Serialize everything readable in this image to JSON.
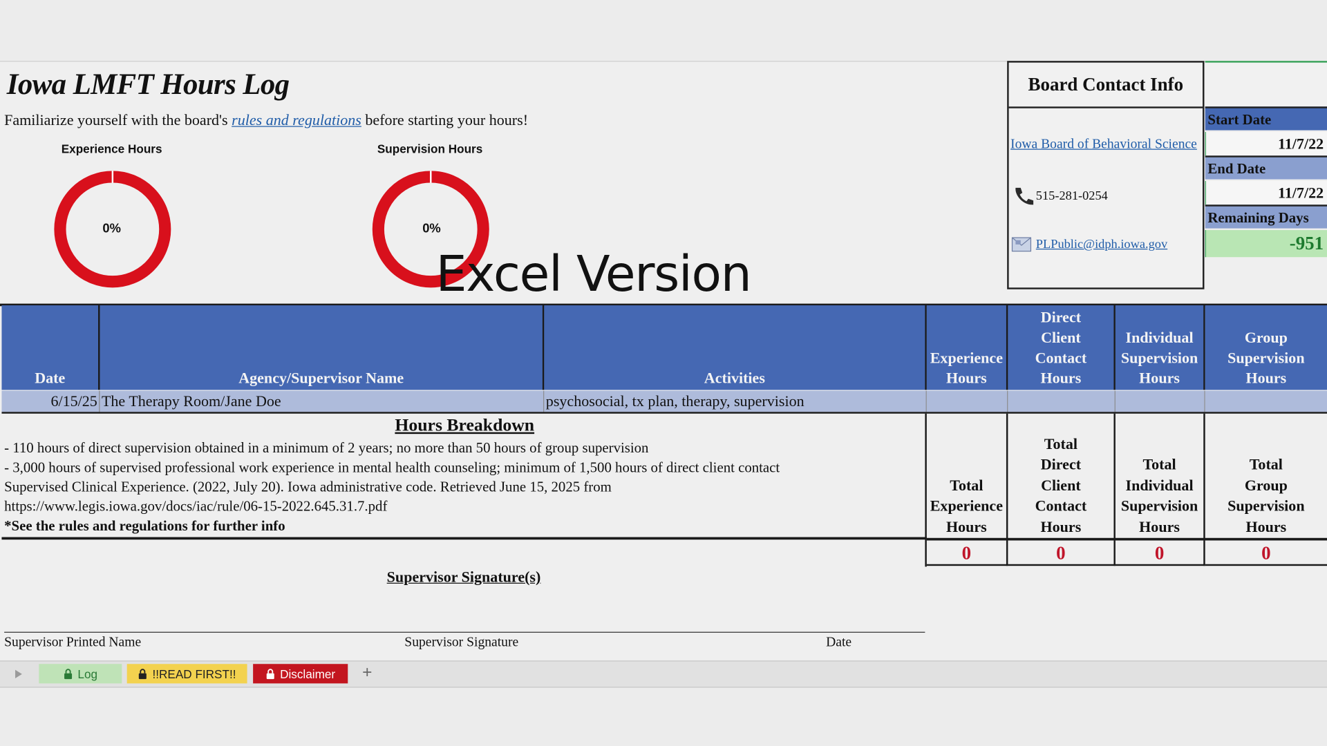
{
  "header": {
    "title": "Iowa LMFT Hours Log",
    "subtitle_before": "Familiarize yourself with the board's",
    "subtitle_link": "rules and regulations",
    "subtitle_after": "before starting your hours!"
  },
  "gauges": [
    {
      "label": "Experience Hours",
      "percent_text": "0%",
      "percent": 0,
      "color": "#d8101c"
    },
    {
      "label": "Supervision Hours",
      "percent_text": "0%",
      "percent": 0,
      "color": "#d8101c"
    }
  ],
  "overlay_text": "Excel Version",
  "contact": {
    "heading": "Board Contact Info",
    "board_link": "Iowa Board of Behavioral Science",
    "phone": "515-281-0254",
    "email": "PLPublic@idph.iowa.gov"
  },
  "dates": {
    "start_label": "Start Date",
    "start_value": "11/7/22",
    "end_label": "End Date",
    "end_value": "11/7/22",
    "remaining_label": "Remaining Days",
    "remaining_value": "-951"
  },
  "table": {
    "columns": {
      "date": "Date",
      "agency": "Agency/Supervisor Name",
      "activities": "Activities",
      "experience": [
        "Experience",
        "Hours"
      ],
      "direct": [
        "Direct",
        "Client",
        "Contact",
        "Hours"
      ],
      "individual": [
        "Individual",
        "Supervision",
        "Hours"
      ],
      "group": [
        "Group",
        "Supervision",
        "Hours"
      ]
    },
    "rows": [
      {
        "date": "6/15/25",
        "agency": "The Therapy Room/Jane Doe",
        "activities": "psychosocial, tx plan, therapy, supervision",
        "experience": "",
        "direct": "",
        "individual": "",
        "group": ""
      }
    ]
  },
  "breakdown": {
    "title": "Hours Breakdown",
    "lines": [
      "- 110 hours of direct supervision obtained in a minimum of 2 years; no more than 50 hours of group supervision",
      "- 3,000 hours of supervised professional work experience in mental health counseling; minimum of 1,500 hours of direct client contact",
      "Supervised Clinical Experience. (2022, July 20). Iowa administrative code. Retrieved June 15, 2025 from",
      "https://www.legis.iowa.gov/docs/iac/rule/06-15-2022.645.31.7.pdf"
    ],
    "note": "*See the rules and regulations for further info"
  },
  "totals": {
    "experience": [
      "Total",
      "Experience",
      "Hours"
    ],
    "direct": [
      "Total",
      "Direct",
      "Client",
      "Contact",
      "Hours"
    ],
    "individual": [
      "Total",
      "Individual",
      "Supervision",
      "Hours"
    ],
    "group": [
      "Total",
      "Group",
      "Supervision",
      "Hours"
    ],
    "values": {
      "experience": "0",
      "direct": "0",
      "individual": "0",
      "group": "0"
    }
  },
  "signature": {
    "title": "Supervisor Signature(s)",
    "printed_name": "Supervisor Printed Name",
    "signature": "Supervisor Signature",
    "date": "Date"
  },
  "tabs": [
    {
      "label": "Log",
      "bg": "#bfe3b7",
      "fg": "#2a7a36"
    },
    {
      "label": "!!READ FIRST!!",
      "bg": "#f3d24f",
      "fg": "#222222"
    },
    {
      "label": "Disclaimer",
      "bg": "#c3151f",
      "fg": "#ffffff"
    }
  ],
  "tab_add": "+"
}
